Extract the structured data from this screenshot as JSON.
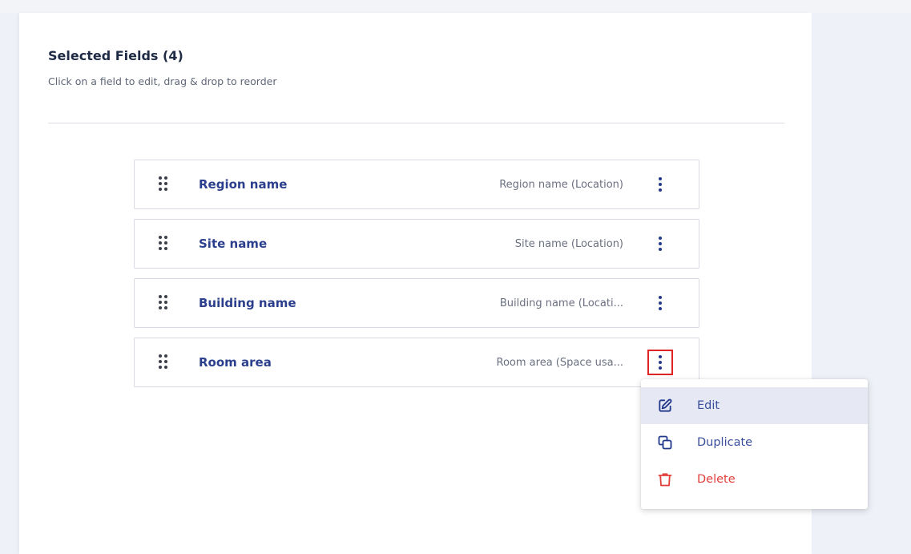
{
  "panel": {
    "title": "Selected Fields (4)",
    "subtitle": "Click on a field to edit, drag & drop to reorder"
  },
  "fields": [
    {
      "name": "Region name",
      "source": "Region name (Location)"
    },
    {
      "name": "Site name",
      "source": "Site name (Location)"
    },
    {
      "name": "Building name",
      "source": "Building name (Locati..."
    },
    {
      "name": "Room area",
      "source": "Room area (Space usa..."
    }
  ],
  "active_field_index": 3,
  "menu": {
    "items": [
      {
        "label": "Edit",
        "icon": "pencil-square-icon"
      },
      {
        "label": "Duplicate",
        "icon": "copy-icon"
      },
      {
        "label": "Delete",
        "icon": "trash-icon"
      }
    ]
  },
  "colors": {
    "accent": "#2c3f8c",
    "danger": "#e2403b",
    "highlight": "#e6e9f3",
    "focus_outline": "#e02424"
  }
}
